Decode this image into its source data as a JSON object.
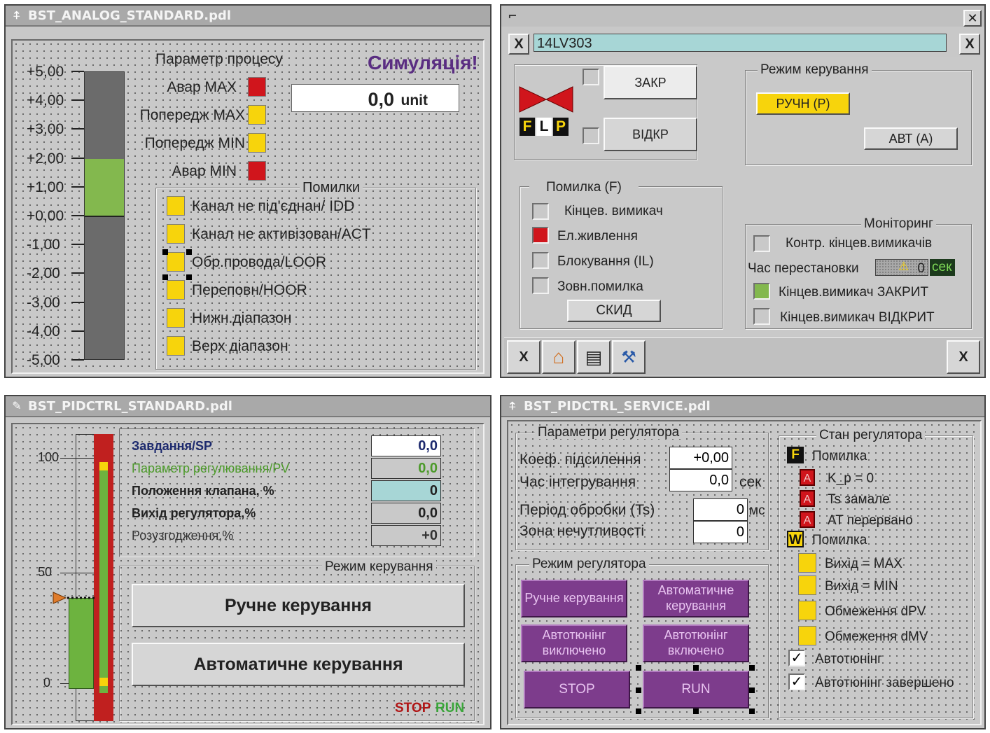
{
  "analog": {
    "title": "BST_ANALOG_STANDARD.pdl",
    "scale": [
      "+5,00",
      "+4,00",
      "+3,00",
      "+2,00",
      "+1,00",
      "+0,00",
      "-1,00",
      "-2,00",
      "-3,00",
      "-4,00",
      "-5,00"
    ],
    "bar_level_low": 0.0,
    "bar_level_high": 2.0,
    "param_label": "Параметр процесу",
    "simulation": "Симуляція!",
    "value": "0,0",
    "unit": "unit",
    "alarms": [
      "Авар MAX",
      "Попередж MAX",
      "Попередж MIN",
      "Авар MIN"
    ],
    "errors_title": "Помилки",
    "errors": [
      "Канал не під'єднан/ IDD",
      "Канал не активізован/ACT",
      "Обр.провода/LOOR",
      "Переповн/HOOR",
      "Нижн.діапазон",
      "Верх діапазон"
    ],
    "colors": {
      "red": "#d0151c",
      "yellow": "#f7d40c",
      "green": "#83b84e",
      "bar": "#6b6b6b",
      "sim": "#5a2d82"
    }
  },
  "valve": {
    "id": "14LV303",
    "close": "ЗАКР",
    "open": "ВІДКР",
    "flp": [
      "F",
      "L",
      "P"
    ],
    "mode_title": "Режим керування",
    "manual": "РУЧН (Р)",
    "auto": "АВТ (А)",
    "error_title": "Помилка (F)",
    "errors": [
      "Кінцев. вимикач",
      "Ел.живлення",
      "Блокування (IL)",
      "Зовн.помилка"
    ],
    "reset": "СКИД",
    "monitor_title": "Моніторинг",
    "mon_limit": "Контр. кінцев.вимикачів",
    "travel_label": "Час перестановки",
    "travel_value": "0",
    "travel_unit": "сек",
    "limit_closed": "Кінцев.вимикач ЗАКРИТ",
    "limit_open": "Кінцев.вимикач ВІДКРИТ",
    "x": "X",
    "close_glyph": "✕"
  },
  "pid": {
    "title": "BST_PIDCTRL_STANDARD.pdl",
    "scale": [
      "100",
      "50",
      "0"
    ],
    "valve_level": 0.5,
    "rows": [
      {
        "label": "Завдання/SP",
        "value": "0,0"
      },
      {
        "label": "Параметр регулювання/PV",
        "value": "0,0"
      },
      {
        "label": "Положення клапана, %",
        "value": "0"
      },
      {
        "label": "Вихід регулятора,%",
        "value": "0,0"
      },
      {
        "label": "Розузгодження,%",
        "value": "+0"
      }
    ],
    "mode_title": "Режим керування",
    "manual": "Ручне керування",
    "auto": "Автоматичне керування",
    "stop": "STOP",
    "run": "RUN"
  },
  "service": {
    "title": "BST_PIDCTRL_SERVICE.pdl",
    "params_title": "Параметри регулятора",
    "gain_label": "Коеф. підсилення",
    "gain_value": "+0,00",
    "int_label": "Час інтегрування",
    "int_value": "0,0",
    "int_unit": "сек",
    "ts_label": "Період обробки (Ts)",
    "ts_value": "0",
    "ts_unit": "мс",
    "dz_label": "Зона нечутливості",
    "dz_value": "0",
    "mode_title": "Режим регулятора",
    "btn_manual": "Ручне керування",
    "btn_auto": "Автоматичне керування",
    "btn_at_off": "Автотюнінг виключено",
    "btn_at_on": "Автотюнінг включено",
    "btn_stop": "STOP",
    "btn_run": "RUN",
    "state_title": "Стан регулятора",
    "f_badge": "F",
    "f_label": "Помилка",
    "f_items": [
      "K_p = 0",
      "Ts замале",
      "AT перервано"
    ],
    "a_badge": "A",
    "w_badge": "W",
    "w_label": "Помилка",
    "w_items": [
      "Вихід = MAX",
      "Вихід = MIN",
      "Обмеження dPV",
      "Обмеження dMV"
    ],
    "checks": [
      "Автотюнінг",
      "Автотюнінг завершено"
    ],
    "check_glyph": "✓"
  }
}
